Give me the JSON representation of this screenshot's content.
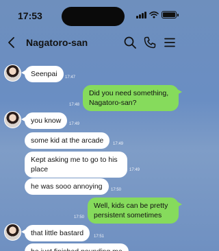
{
  "status_bar": {
    "time": "17:53"
  },
  "header": {
    "title": "Nagatoro-san"
  },
  "colors": {
    "incoming_bubble": "#ffffff",
    "outgoing_bubble": "#86db5c",
    "background": "#6a8ec3"
  },
  "icons": {
    "back": "chevron-left-icon",
    "search": "search-icon",
    "call": "phone-icon",
    "menu": "menu-icon"
  },
  "messages": [
    {
      "direction": "in",
      "text": "Seenpai",
      "time": "17:47"
    },
    {
      "direction": "out",
      "text": "Did you need something, Nagatoro-san?",
      "time": "17:48"
    },
    {
      "direction": "in",
      "text": "you know",
      "time": "17:49"
    },
    {
      "direction": "in",
      "text": "some kid at the arcade",
      "time": "17:49"
    },
    {
      "direction": "in",
      "text": "Kept asking me to go to his place",
      "time": "17:49"
    },
    {
      "direction": "in",
      "text": "he was sooo annoying",
      "time": "17:50"
    },
    {
      "direction": "out",
      "text": "Well, kids can be pretty persistent sometimes",
      "time": "17:50"
    },
    {
      "direction": "in",
      "text": "that little bastard",
      "time": "17:51"
    },
    {
      "direction": "in",
      "text": "he just finished pounding me",
      "time": ""
    }
  ]
}
